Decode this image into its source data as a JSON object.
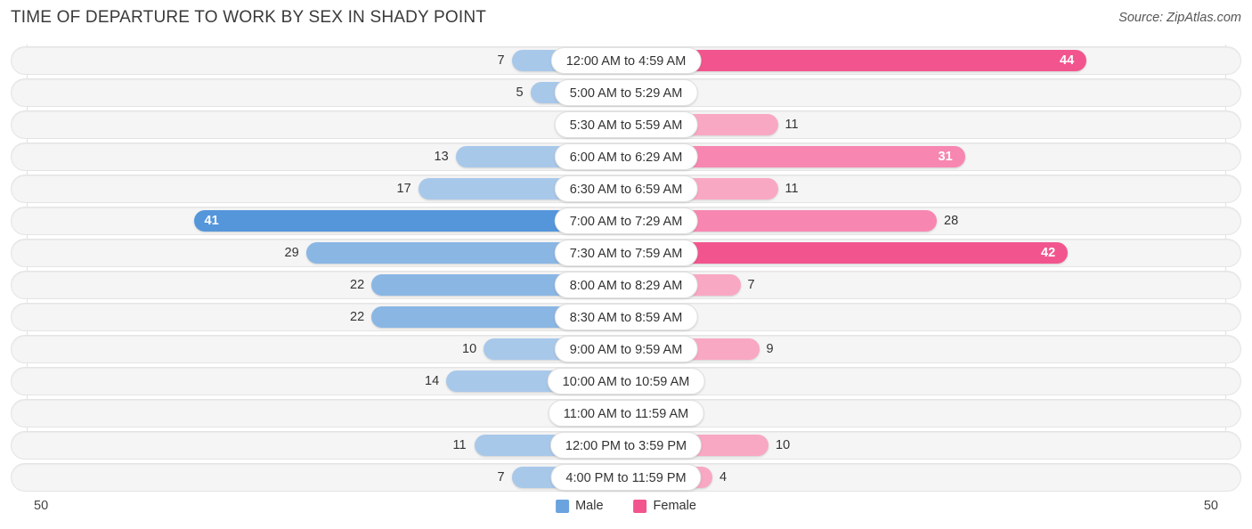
{
  "header": {
    "title": "TIME OF DEPARTURE TO WORK BY SEX IN SHADY POINT",
    "source": "Source: ZipAtlas.com"
  },
  "axis": {
    "left_label": "50",
    "right_label": "50"
  },
  "legend": {
    "items": [
      {
        "label": "Male",
        "color": "#6aa3de"
      },
      {
        "label": "Female",
        "color": "#f2558e"
      }
    ]
  },
  "colors": {
    "male_light": "#a8c8ea",
    "male_mid": "#8ab6e4",
    "male_dark": "#5596db",
    "female_light": "#f9a8c4",
    "female_mid": "#f787b0",
    "female_dark": "#f2558e",
    "track_bg": "#f5f5f5",
    "track_border": "#e4e4e4",
    "gridline": "#e2e2e2"
  },
  "chart_data": {
    "type": "bar",
    "title": "TIME OF DEPARTURE TO WORK BY SEX IN SHADY POINT",
    "subtitle": "",
    "xlabel": "",
    "ylabel": "",
    "orientation": "horizontal-diverging",
    "xlim": [
      50,
      50
    ],
    "grid": true,
    "legend_position": "bottom-center",
    "categories": [
      "12:00 AM to 4:59 AM",
      "5:00 AM to 5:29 AM",
      "5:30 AM to 5:59 AM",
      "6:00 AM to 6:29 AM",
      "6:30 AM to 6:59 AM",
      "7:00 AM to 7:29 AM",
      "7:30 AM to 7:59 AM",
      "8:00 AM to 8:29 AM",
      "8:30 AM to 8:59 AM",
      "9:00 AM to 9:59 AM",
      "10:00 AM to 10:59 AM",
      "11:00 AM to 11:59 AM",
      "12:00 PM to 3:59 PM",
      "4:00 PM to 11:59 PM"
    ],
    "series": [
      {
        "name": "Male",
        "side": "left",
        "values": [
          7,
          5,
          0,
          13,
          17,
          41,
          29,
          22,
          22,
          10,
          14,
          0,
          11,
          7
        ]
      },
      {
        "name": "Female",
        "side": "right",
        "values": [
          44,
          0,
          11,
          31,
          11,
          28,
          42,
          7,
          0,
          9,
          0,
          0,
          10,
          4
        ]
      }
    ]
  }
}
